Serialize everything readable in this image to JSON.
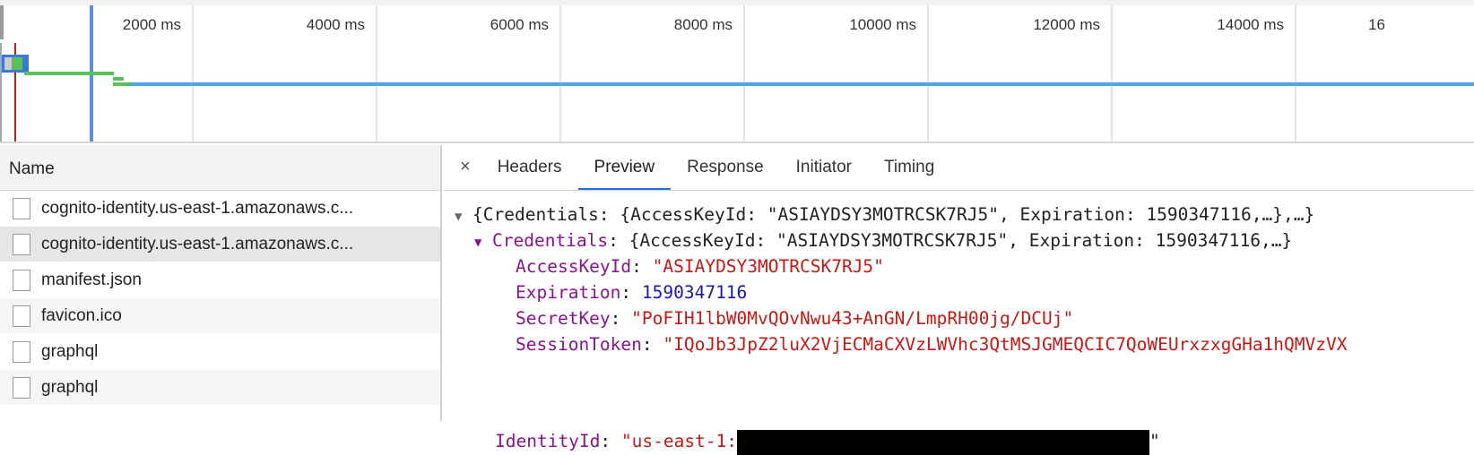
{
  "timeline": {
    "ticks": [
      "2000 ms",
      "4000 ms",
      "6000 ms",
      "8000 ms",
      "10000 ms",
      "12000 ms",
      "14000 ms",
      "16"
    ]
  },
  "requests": {
    "header": "Name",
    "rows": [
      "cognito-identity.us-east-1.amazonaws.c...",
      "cognito-identity.us-east-1.amazonaws.c...",
      "manifest.json",
      "favicon.ico",
      "graphql",
      "graphql"
    ],
    "selected_index": 1
  },
  "tabs": {
    "close": "×",
    "items": [
      "Headers",
      "Preview",
      "Response",
      "Initiator",
      "Timing"
    ],
    "active": "Preview"
  },
  "preview": {
    "root_summary": "{Credentials: {AccessKeyId: \"ASIAYDSY3MOTRCSK7RJ5\", Expiration: 1590347116,…},…}",
    "credentials_key": "Credentials",
    "credentials_summary": ": {AccessKeyId: \"ASIAYDSY3MOTRCSK7RJ5\", Expiration: 1590347116,…}",
    "fields": [
      {
        "key": "AccessKeyId",
        "value": "\"ASIAYDSY3MOTRCSK7RJ5\"",
        "type": "str"
      },
      {
        "key": "Expiration",
        "value": "1590347116",
        "type": "num"
      },
      {
        "key": "SecretKey",
        "value": "\"PoFIH1lbW0MvQOvNwu43+AnGN/LmpRH00jg/DCUj\"",
        "type": "str"
      },
      {
        "key": "SessionToken",
        "value": "\"IQoJb3JpZ2luX2VjECMaCXVzLWVhc3QtMSJGMEQCIC7QoWEUrxzxgGHa1hQMVzVX",
        "type": "str"
      }
    ],
    "identity_key": "IdentityId",
    "identity_value_prefix": "\"us-east-1:",
    "identity_value_suffix": "\""
  }
}
